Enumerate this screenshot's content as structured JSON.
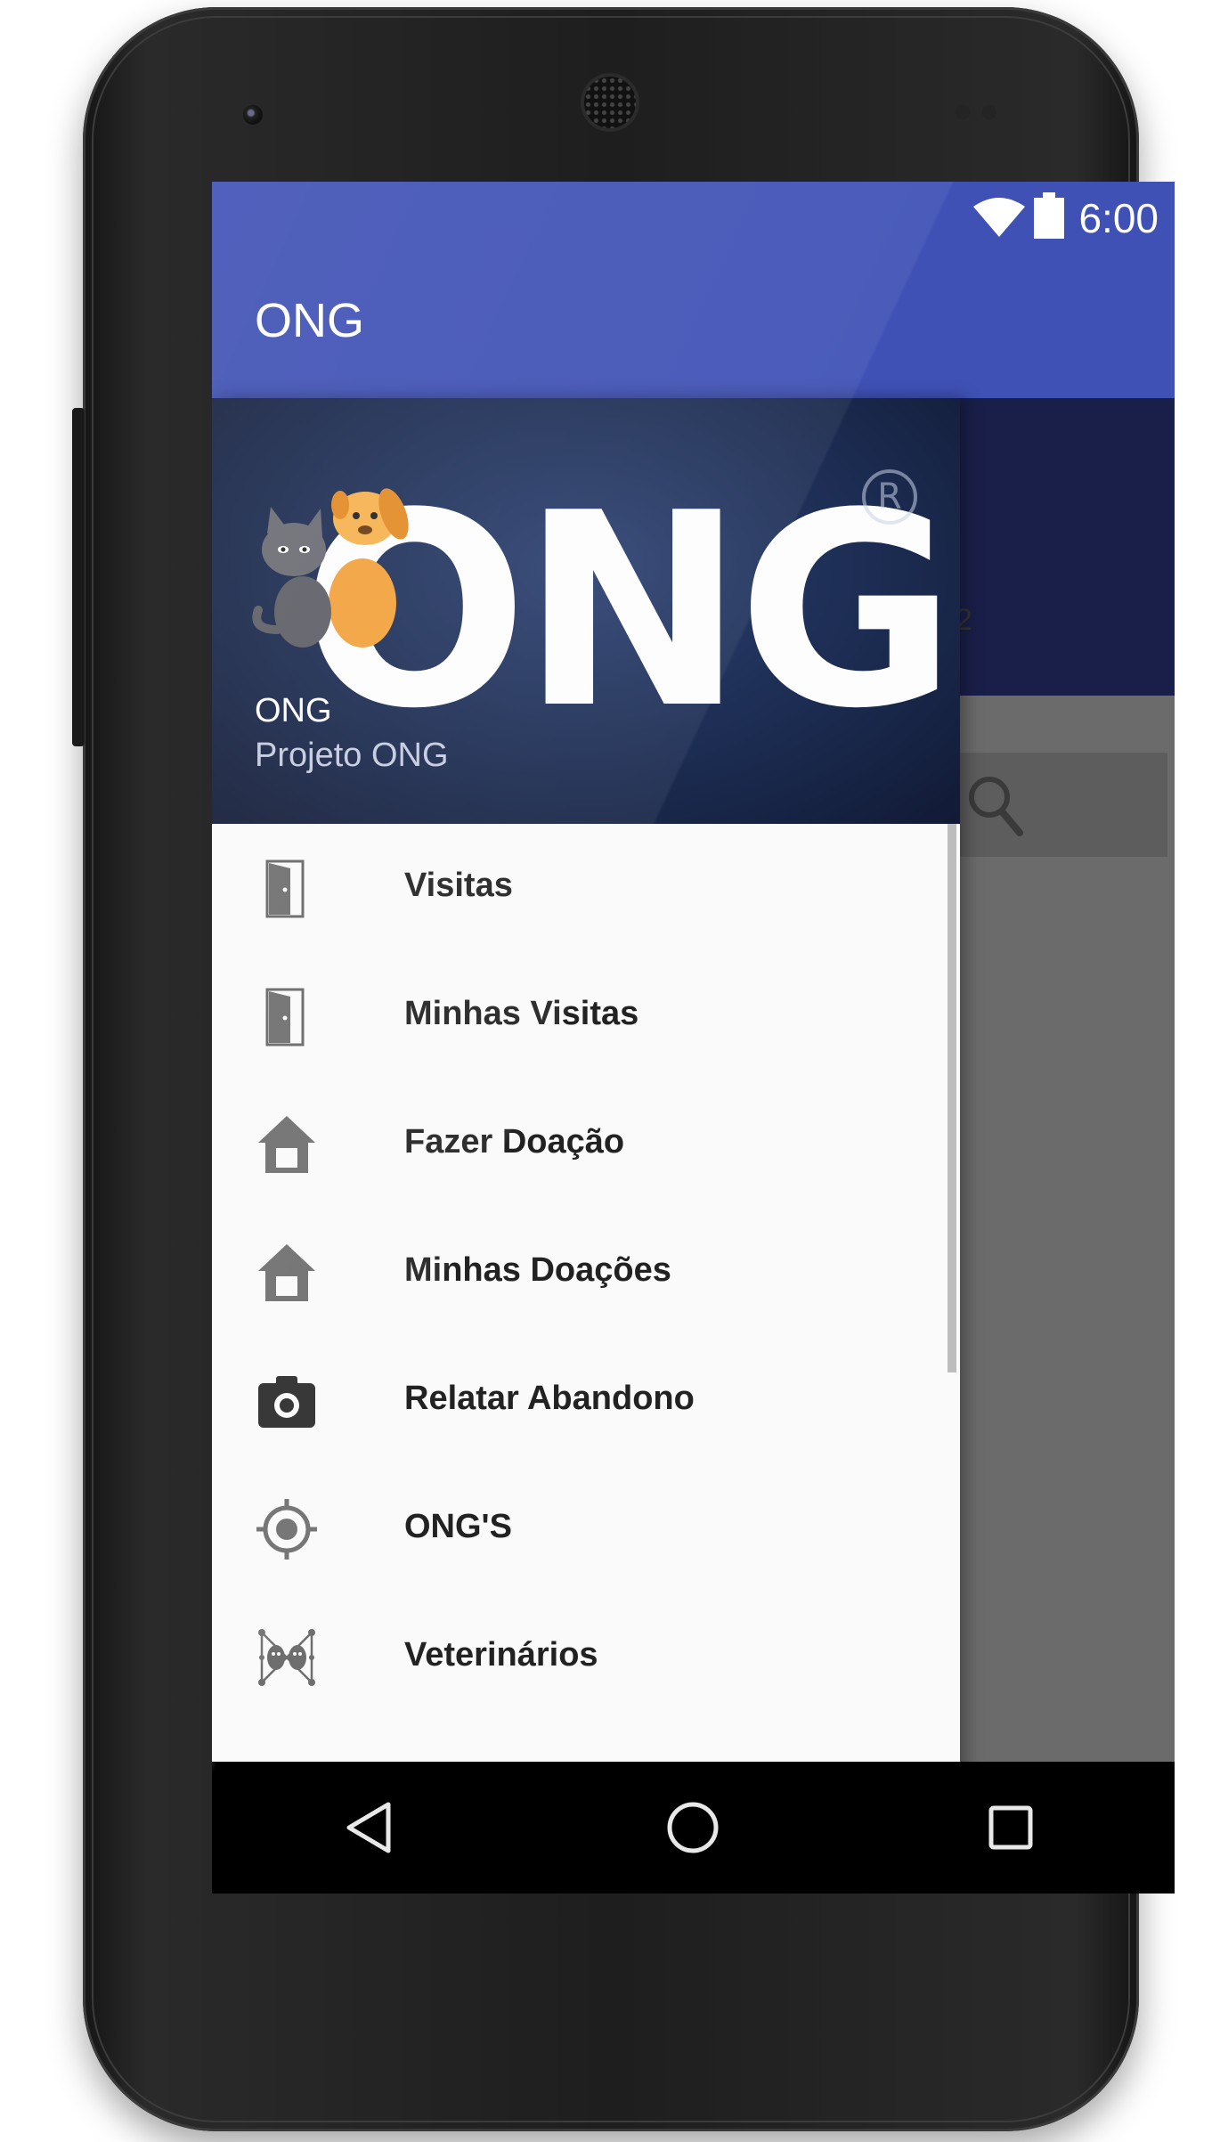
{
  "status_bar": {
    "time": "6:00",
    "icons": [
      "wifi-icon",
      "battery-icon"
    ]
  },
  "app_bar": {
    "title": "ONG",
    "color": "#3f51b5"
  },
  "background": {
    "partial_text": "2",
    "search_icon": "search-icon"
  },
  "drawer": {
    "header": {
      "logo_text": "ONG",
      "reg_mark": "R",
      "name": "ONG",
      "subtitle": "Projeto ONG"
    },
    "items": [
      {
        "label": "Visitas",
        "icon": "door-icon"
      },
      {
        "label": "Minhas Visitas",
        "icon": "door-icon"
      },
      {
        "label": "Fazer Doação",
        "icon": "house-icon"
      },
      {
        "label": "Minhas Doações",
        "icon": "house-icon"
      },
      {
        "label": "Relatar Abandono",
        "icon": "camera-icon"
      },
      {
        "label": "ONG'S",
        "icon": "gps-icon"
      },
      {
        "label": "Veterinários",
        "icon": "pets-network-icon"
      }
    ]
  },
  "nav_bar": {
    "icons": [
      "back-icon",
      "home-icon",
      "recent-apps-icon"
    ]
  }
}
